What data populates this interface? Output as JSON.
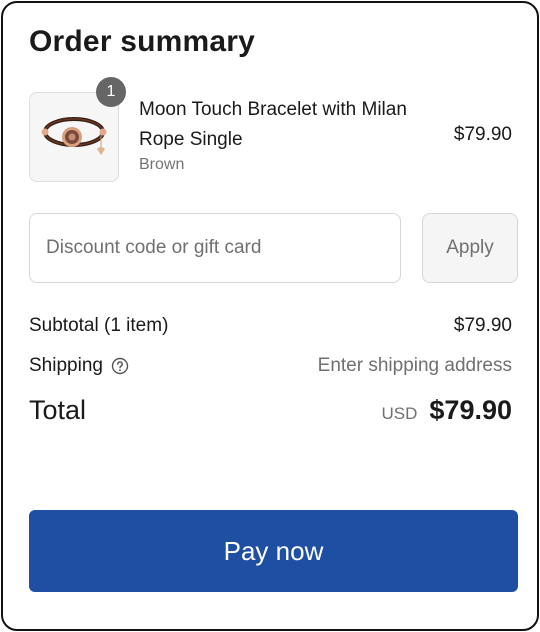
{
  "summary": {
    "title": "Order summary"
  },
  "item": {
    "quantity": "1",
    "name": "Moon Touch Bracelet with Milan Rope Single",
    "variant": "Brown",
    "price": "$79.90"
  },
  "discount": {
    "placeholder": "Discount code or gift card",
    "apply_label": "Apply"
  },
  "totals": {
    "subtotal_label": "Subtotal (1 item)",
    "subtotal_value": "$79.90",
    "shipping_label": "Shipping",
    "shipping_value": "Enter shipping address",
    "total_label": "Total",
    "currency": "USD",
    "total_value": "$79.90"
  },
  "pay": {
    "label": "Pay now"
  },
  "colors": {
    "accent": "#1f4fa3",
    "badge": "#666666"
  }
}
